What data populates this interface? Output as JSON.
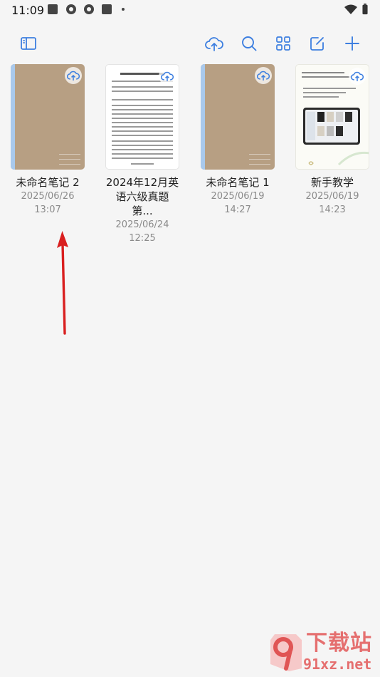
{
  "status_bar": {
    "time": "11:09"
  },
  "notebooks": [
    {
      "title": "未命名笔记 2",
      "date": "2025/06/26",
      "time": "13:07",
      "cover": "kraft"
    },
    {
      "title": "2024年12月英语六级真题第...",
      "title_line1": "2024年12月英",
      "title_line2": "语六级真题第...",
      "date": "2025/06/24",
      "time": "12:25",
      "cover": "document"
    },
    {
      "title": "未命名笔记 1",
      "date": "2025/06/19",
      "time": "14:27",
      "cover": "kraft"
    },
    {
      "title": "新手教学",
      "date": "2025/06/19",
      "time": "14:23",
      "cover": "tutorial"
    }
  ],
  "watermark": {
    "brand": "下载站",
    "url": "91xz.net",
    "logo_text": "9"
  },
  "colors": {
    "accent": "#3d7fe0",
    "background": "#f5f5f5",
    "kraft": "#b79f83",
    "spine": "#a9c9ec",
    "annotation_arrow": "#d91f1f"
  }
}
